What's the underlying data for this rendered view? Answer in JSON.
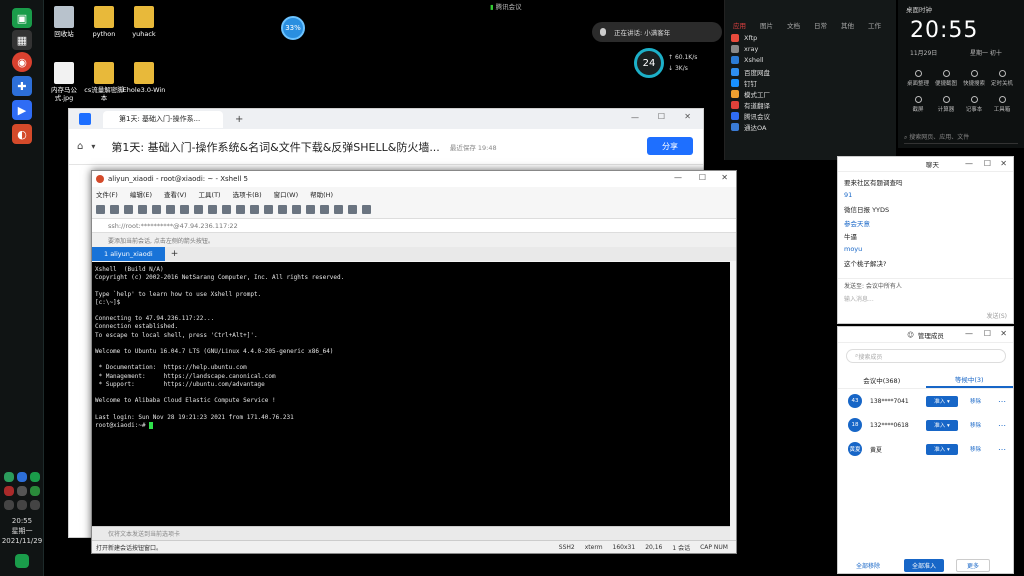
{
  "taskbar": {
    "clock_time": "20:55",
    "clock_day": "星期一",
    "clock_date": "2021/11/29"
  },
  "desktop": {
    "icons": [
      {
        "label": "回收站"
      },
      {
        "label": "python"
      },
      {
        "label": "yuhack"
      },
      {
        "label": "内存马公式.jpg"
      },
      {
        "label": "cs流量解密脚本"
      },
      {
        "label": "Ehole3.0-Win"
      }
    ],
    "badge": "33%"
  },
  "top": {
    "meeting_label": "腾讯会议",
    "speech_text": "正在讲话: 小满客年",
    "gauge_value": "24",
    "speed_up": "60.1K/s",
    "speed_down": "3K/s"
  },
  "browser": {
    "tab_title": "第1天: 基础入门-操作系...",
    "doc_title": "第1天: 基础入门-操作系统&名词&文件下载&反弹SHELL&防火墙...",
    "saved_text": "最近保存 19:48",
    "share_label": "分享"
  },
  "xshell": {
    "title": "aliyun_xiaodi - root@xiaodi: ~ - Xshell 5",
    "menu": [
      "文件(F)",
      "编辑(E)",
      "查看(V)",
      "工具(T)",
      "选项卡(B)",
      "窗口(W)",
      "帮助(H)"
    ],
    "address": "ssh://root:**********@47.94.236.117:22",
    "hint": "要添加当前会话, 点击左侧的箭头按钮。",
    "tab_label": "1 aliyun_xiaodi",
    "terminal_lines": [
      "Xshell  (Build N/A)",
      "Copyright (c) 2002-2016 NetSarang Computer, Inc. All rights reserved.",
      "",
      "Type `help' to learn how to use Xshell prompt.",
      "[c:\\~]$",
      "",
      "Connecting to 47.94.236.117:22...",
      "Connection established.",
      "To escape to local shell, press 'Ctrl+Alt+]'.",
      "",
      "Welcome to Ubuntu 16.04.7 LTS (GNU/Linux 4.4.0-205-generic x86_64)",
      "",
      " * Documentation:  https://help.ubuntu.com",
      " * Management:     https://landscape.canonical.com",
      " * Support:        https://ubuntu.com/advantage",
      "",
      "Welcome to Alibaba Cloud Elastic Compute Service !",
      "",
      "Last login: Sun Nov 28 19:21:23 2021 from 171.40.76.231",
      "root@xiaodi:~# "
    ],
    "input_placeholder": "仅将文本发送到当前选项卡",
    "status_left": "打开新建会话按钮窗口。",
    "status_proto": "SSH2",
    "status_term": "xterm",
    "status_size": "160x31",
    "status_pos": "20,16",
    "status_sessions": "1 会话",
    "status_caps": "CAP NUM"
  },
  "drawer": {
    "tabs": [
      "应用",
      "图片",
      "文档",
      "日常",
      "其他",
      "工作"
    ],
    "items": [
      {
        "label": "Xftp",
        "color": "#e84b3c"
      },
      {
        "label": "xray",
        "color": "#888888"
      },
      {
        "label": "Xshell",
        "color": "#2b7bd6"
      },
      {
        "label": "百度网盘",
        "color": "#2e8ef0"
      },
      {
        "label": "钉钉",
        "color": "#1890ff"
      },
      {
        "label": "模式工厂",
        "color": "#f0a030"
      },
      {
        "label": "有道翻译",
        "color": "#e0413a"
      },
      {
        "label": "腾讯会议",
        "color": "#2f6cf5"
      },
      {
        "label": "通达OA",
        "color": "#3a7bd5"
      }
    ]
  },
  "clockpanel": {
    "title": "桌面时钟",
    "time": "20:55",
    "date": "11月29日",
    "weekday": "星期一 初十",
    "shortcuts": [
      "桌面整理",
      "便捷截图",
      "快捷搜索",
      "定时关机",
      "截屏",
      "计算器",
      "记事本",
      "工具箱"
    ],
    "search_placeholder": "搜索网页、应用、文件"
  },
  "chat": {
    "title": "聊天",
    "lines": [
      {
        "text": "要来社区有题调查吗",
        "color": "#222"
      },
      {
        "text": "91",
        "color": "#1766c7"
      },
      {
        "text": "微信日报 YYDS",
        "color": "#222"
      },
      {
        "text": "参会天意",
        "color": "#1766c7"
      },
      {
        "text": "牛逼",
        "color": "#222"
      },
      {
        "text": "moyu",
        "color": "#1766c7"
      },
      {
        "text": "这个桃子解决?",
        "color": "#222"
      }
    ],
    "send_to": "发送至: 会议中所有人",
    "input_placeholder": "输入消息...",
    "send_label": "发送(S)"
  },
  "members": {
    "title": "管理成员",
    "search_placeholder": "搜索成员",
    "tab_in": "会议中(368)",
    "tab_wait": "等候中(3)",
    "rows": [
      {
        "avatar": "43",
        "name": "138****7041"
      },
      {
        "avatar": "18",
        "name": "132****0618"
      },
      {
        "avatar": "黄夏",
        "name": "黄夏"
      }
    ],
    "admit_label": "准入",
    "remove_label": "移除",
    "remove_all": "全部移除",
    "admit_all": "全部准入",
    "more": "更多"
  }
}
